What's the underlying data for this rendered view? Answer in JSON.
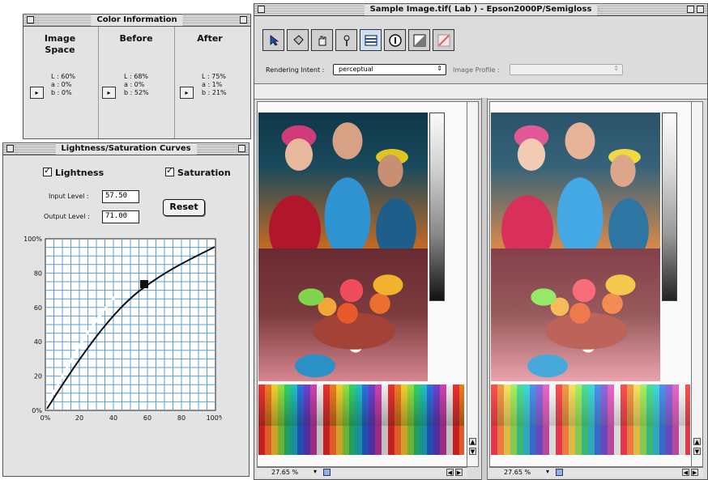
{
  "color_info": {
    "title": "Color Information",
    "columns": [
      {
        "header": "Image\nSpace",
        "lines": [
          "L : 60%",
          "a : 0%",
          "b : 0%"
        ]
      },
      {
        "header": "Before",
        "lines": [
          "L : 68%",
          "a : 0%",
          "b : 52%"
        ]
      },
      {
        "header": "After",
        "lines": [
          "L : 75%",
          "a : 1%",
          "b : 21%"
        ]
      }
    ]
  },
  "curves": {
    "title": "Lightness/Saturation Curves",
    "lightness_label": "Lightness",
    "saturation_label": "Saturation",
    "input_label": "Input Level :",
    "input_value": "57.50",
    "output_label": "Output Level :",
    "output_value": "71.00",
    "reset_label": "Reset",
    "y_ticks": [
      "100%",
      "80",
      "60",
      "40",
      "20",
      "0%"
    ],
    "x_ticks": [
      "0%",
      "20",
      "40",
      "60",
      "80",
      "100%"
    ],
    "grid_color": "#5b9fd8"
  },
  "image_window": {
    "title": "Sample Image.tif( Lab ) - Epson2000P/Semigloss",
    "tools": [
      "select-arrow-icon",
      "bucket-icon",
      "hand-icon",
      "eyedropper-icon",
      "calculator-icon",
      "info-icon",
      "split-view-icon",
      "diagonal-view-icon"
    ],
    "rendering_intent_label": "Rendering Intent :",
    "rendering_intent_value": "perceptual",
    "image_profile_label": "Image Profile :",
    "left_zoom": "27.65 %",
    "right_zoom": "27.65 %"
  }
}
